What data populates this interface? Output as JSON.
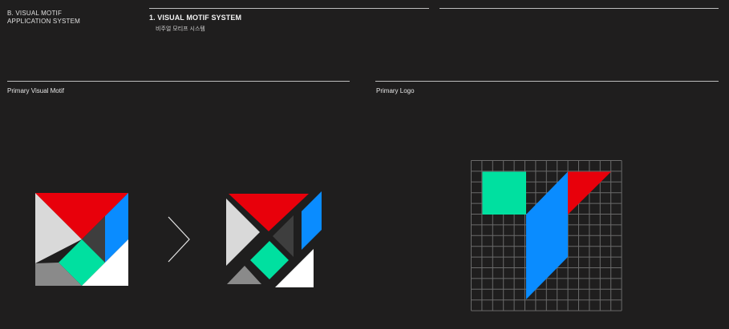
{
  "header": {
    "section_line1": "B. VISUAL MOTIF",
    "section_line2": "APPLICATION SYSTEM",
    "title": "1. VISUAL MOTIF SYSTEM",
    "subtitle": "비주얼 모티프 시스템"
  },
  "left_panel": {
    "label": "Primary Visual Motif"
  },
  "right_panel": {
    "label": "Primary Logo"
  },
  "colors": {
    "background": "#1f1e1e",
    "red": "#e8000b",
    "blue": "#0a8cff",
    "green": "#00e0a0",
    "light_gray": "#d9d9d9",
    "mid_gray": "#8a8a8a",
    "dark_gray": "#3e3e3e",
    "white": "#ffffff",
    "grid_line": "#6a6a6a"
  },
  "icons": {
    "arrow": "chevron-right-icon"
  }
}
